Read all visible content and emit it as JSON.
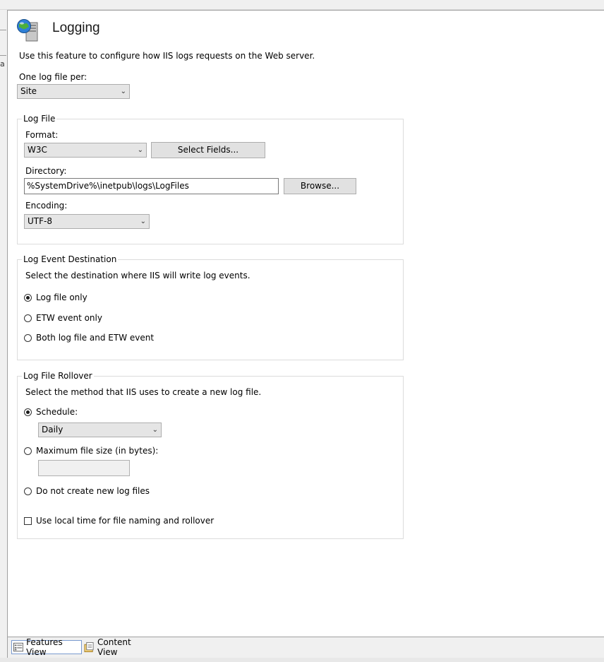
{
  "page": {
    "title": "Logging",
    "description": "Use this feature to configure how IIS logs requests on the Web server.",
    "one_log_file_per": {
      "label": "One log file per:",
      "value": "Site"
    }
  },
  "log_file": {
    "legend": "Log File",
    "format_label": "Format:",
    "format_value": "W3C",
    "select_fields_label": "Select Fields...",
    "directory_label": "Directory:",
    "directory_value": "%SystemDrive%\\inetpub\\logs\\LogFiles",
    "browse_label": "Browse...",
    "encoding_label": "Encoding:",
    "encoding_value": "UTF-8"
  },
  "log_event_destination": {
    "legend": "Log Event Destination",
    "description": "Select the destination where IIS will write log events.",
    "options": [
      {
        "label": "Log file only",
        "selected": true
      },
      {
        "label": "ETW event only",
        "selected": false
      },
      {
        "label": "Both log file and ETW event",
        "selected": false
      }
    ]
  },
  "log_file_rollover": {
    "legend": "Log File Rollover",
    "description": "Select the method that IIS uses to create a new log file.",
    "schedule_label": "Schedule:",
    "schedule_selected": true,
    "schedule_value": "Daily",
    "max_size_label": "Maximum file size (in bytes):",
    "max_size_value": "",
    "no_new_label": "Do not create new log files",
    "local_time_label": "Use local time for file naming and rollover",
    "local_time_checked": false
  },
  "bottom_tabs": {
    "features_view": "Features View",
    "content_view": "Content View"
  },
  "left_fragment": "a"
}
